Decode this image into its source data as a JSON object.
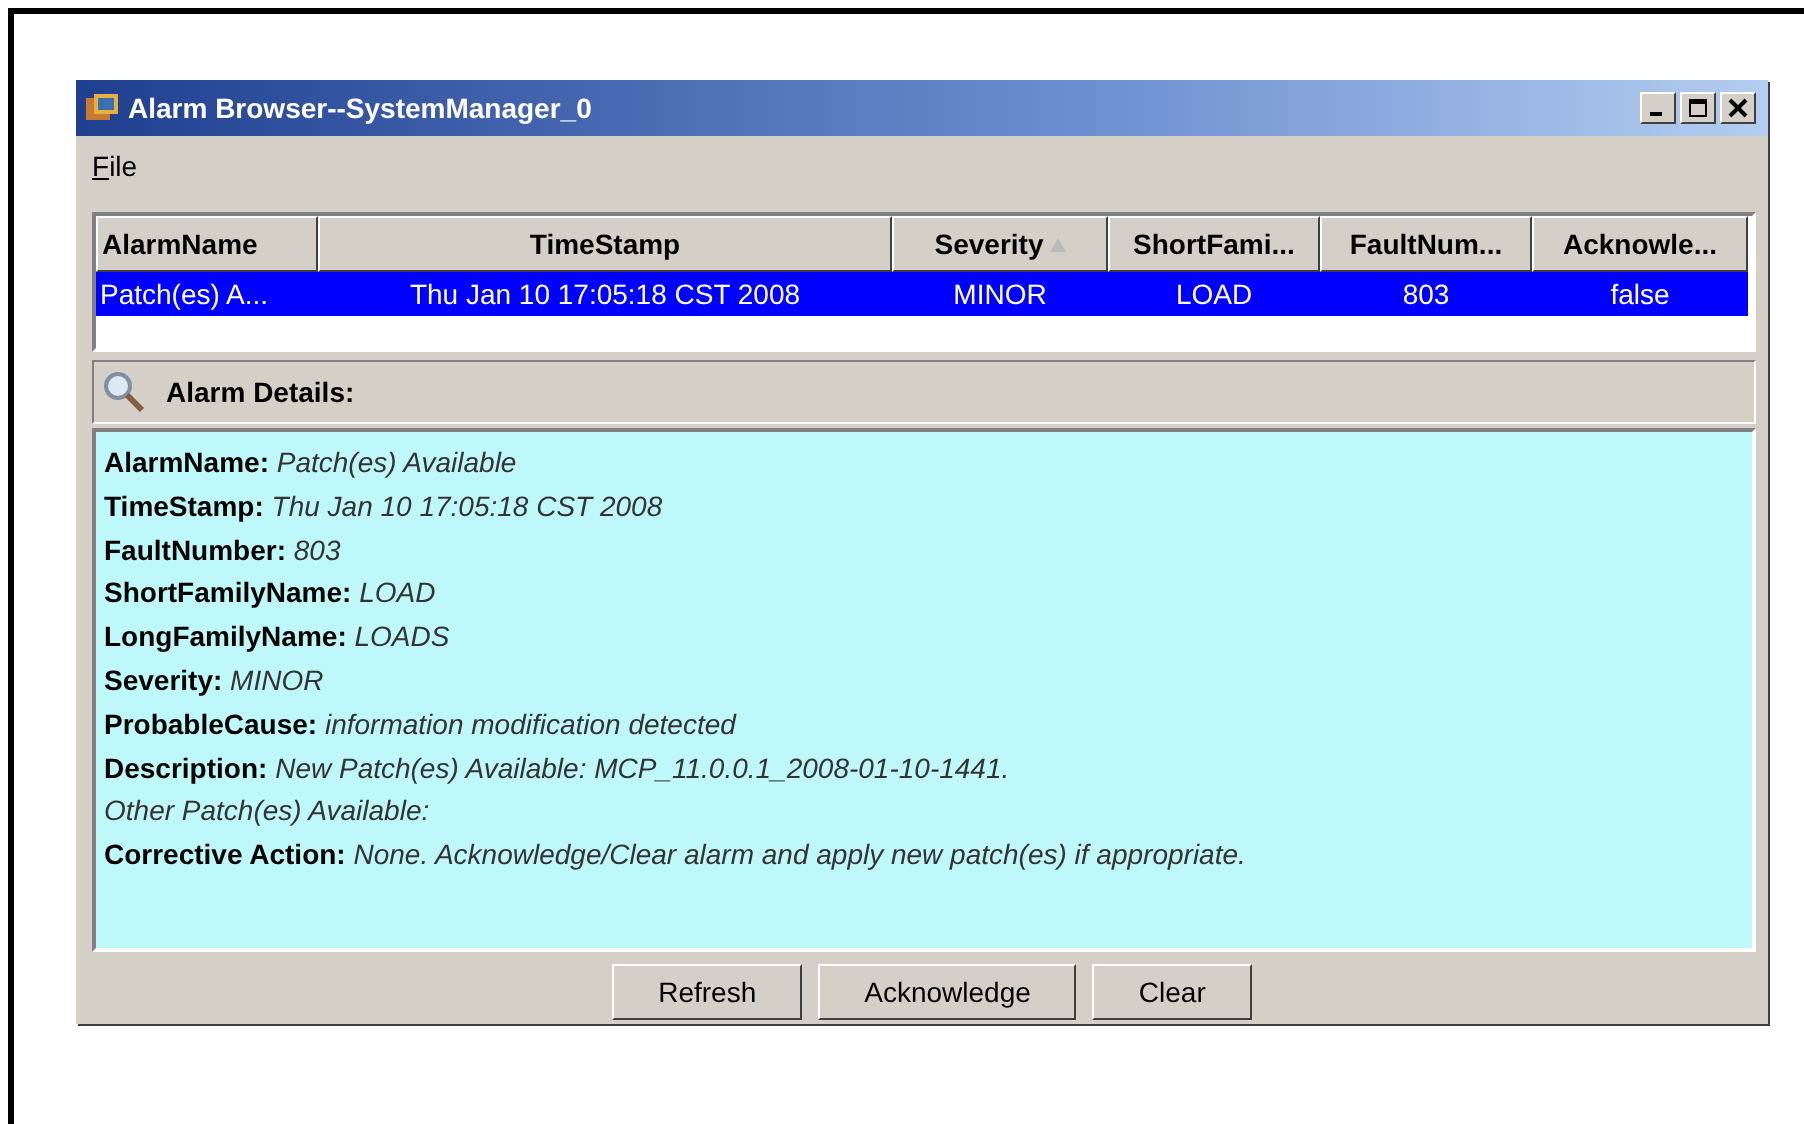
{
  "window": {
    "title": "Alarm Browser--SystemManager_0"
  },
  "menu": [
    "File"
  ],
  "table": {
    "columns": [
      {
        "label": "AlarmName",
        "sorted": false
      },
      {
        "label": "TimeStamp",
        "sorted": false
      },
      {
        "label": "Severity",
        "sorted": true
      },
      {
        "label": "ShortFami...",
        "sorted": false
      },
      {
        "label": "FaultNum...",
        "sorted": false
      },
      {
        "label": "Acknowle...",
        "sorted": false
      }
    ],
    "rows": [
      {
        "selected": true,
        "cells": [
          "Patch(es) A...",
          "Thu Jan 10 17:05:18 CST 2008",
          "MINOR",
          "LOAD",
          "803",
          "false"
        ]
      }
    ]
  },
  "details": {
    "title": "Alarm Details:",
    "lines": [
      {
        "label": "AlarmName:",
        "value": "Patch(es) Available"
      },
      {
        "label": "TimeStamp:",
        "value": "Thu Jan 10 17:05:18 CST 2008"
      },
      {
        "label": "FaultNumber:",
        "value": "803"
      },
      {
        "label": "ShortFamilyName:",
        "value": "LOAD"
      },
      {
        "label": "LongFamilyName:",
        "value": "LOADS"
      },
      {
        "label": "Severity:",
        "value": "MINOR"
      },
      {
        "label": "ProbableCause:",
        "value": "information modification detected"
      },
      {
        "label": "Description:",
        "value": "New Patch(es) Available: MCP_11.0.0.1_2008-01-10-1441."
      },
      {
        "value": "Other Patch(es) Available:"
      },
      {
        "label": "Corrective Action:",
        "value": "None. Acknowledge/Clear alarm and apply new patch(es) if appropriate."
      }
    ]
  },
  "buttons": [
    "Refresh",
    "Acknowledge",
    "Clear"
  ]
}
